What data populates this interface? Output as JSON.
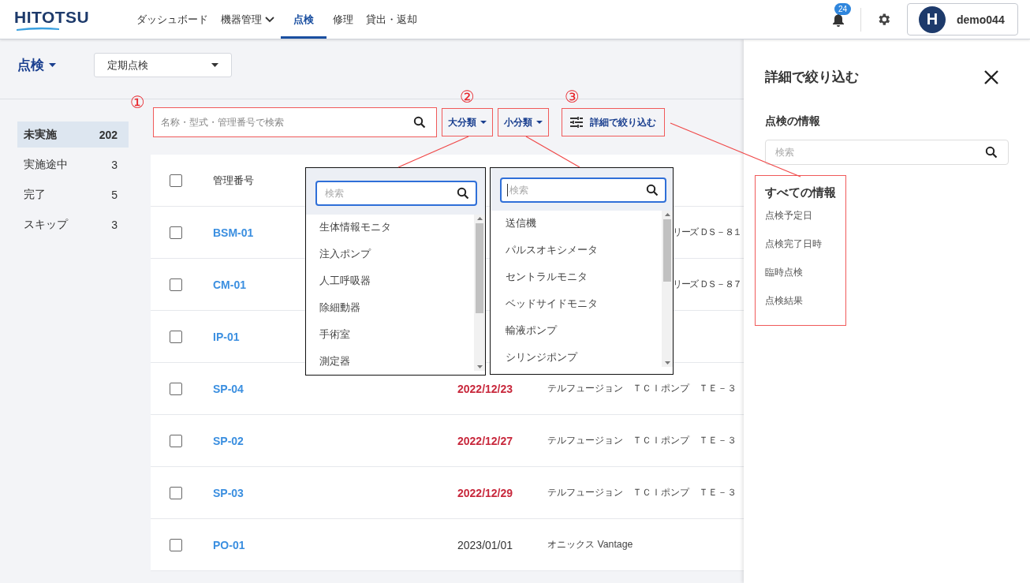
{
  "brand": {
    "logo": "HITOTSU"
  },
  "nav": [
    {
      "label": "ダッシュボード",
      "selected": false,
      "has_menu": false
    },
    {
      "label": "機器管理",
      "selected": false,
      "has_menu": true
    },
    {
      "label": "点検",
      "selected": true,
      "has_menu": false
    },
    {
      "label": "修理",
      "selected": false,
      "has_menu": false
    },
    {
      "label": "貸出・返却",
      "selected": false,
      "has_menu": false
    }
  ],
  "header_actions": {
    "notification_count": "24",
    "user": {
      "avatar": "H",
      "name": "demo044"
    }
  },
  "page": {
    "title": "点検",
    "view_select": {
      "value": "定期点検"
    }
  },
  "sidebar": {
    "items": [
      {
        "label": "未実施",
        "count": "202",
        "selected": true
      },
      {
        "label": "実施途中",
        "count": "3",
        "selected": false
      },
      {
        "label": "完了",
        "count": "5",
        "selected": false
      },
      {
        "label": "スキップ",
        "count": "3",
        "selected": false
      }
    ]
  },
  "filters": {
    "search": {
      "placeholder": "名称・型式・管理番号で検索",
      "marker": "①",
      "highlighted": true
    },
    "buttons": [
      {
        "kind": "dropdown",
        "label": "大分類",
        "marker": "②",
        "highlighted": true
      },
      {
        "kind": "dropdown",
        "label": "小分類",
        "highlighted": true
      },
      {
        "kind": "detail",
        "label": "詳細で絞り込む",
        "marker": "③",
        "highlighted": true
      }
    ]
  },
  "table": {
    "columns": [
      "管理番号"
    ],
    "header_checked": false,
    "rows": [
      {
        "kind": "covered",
        "id": "BSM-01",
        "checked": false,
        "model": "リーズ ＤＳ－８１"
      },
      {
        "kind": "covered",
        "id": "CM-01",
        "checked": false,
        "model": "リーズ ＤＳ－８７"
      },
      {
        "kind": "covered",
        "id": "IP-01",
        "checked": false
      },
      {
        "kind": "full",
        "id": "SP-04",
        "checked": false,
        "date": "2022/12/23",
        "overdue": true,
        "model": "テルフュージョン　ＴＣＩポンプ　ＴＥ－３"
      },
      {
        "kind": "full",
        "id": "SP-02",
        "checked": false,
        "date": "2022/12/27",
        "overdue": true,
        "model": "テルフュージョン　ＴＣＩポンプ　ＴＥ－３"
      },
      {
        "kind": "full",
        "id": "SP-03",
        "checked": false,
        "date": "2022/12/29",
        "overdue": true,
        "model": "テルフュージョン　ＴＣＩポンプ　ＴＥ－３"
      },
      {
        "kind": "full",
        "id": "PO-01",
        "checked": false,
        "date": "2023/01/01",
        "overdue": false,
        "model": "オニックス Vantage"
      }
    ]
  },
  "dropdowns": [
    {
      "search_placeholder": "検索",
      "focused": false,
      "items": [
        "生体情報モニタ",
        "注入ポンプ",
        "人工呼吸器",
        "除細動器",
        "手術室",
        "測定器"
      ]
    },
    {
      "search_placeholder": "検索",
      "focused": true,
      "items": [
        "送信機",
        "パルスオキシメータ",
        "セントラルモニタ",
        "ベッドサイドモニタ",
        "輸液ポンプ",
        "シリンジポンプ"
      ]
    }
  ],
  "drawer": {
    "title": "詳細で絞り込む",
    "section": "点検の情報",
    "search_placeholder": "検索",
    "group": {
      "title": "すべての情報",
      "highlighted": true,
      "items": [
        "点検予定日",
        "点検完了日時",
        "臨時点検",
        "点検結果"
      ]
    }
  }
}
